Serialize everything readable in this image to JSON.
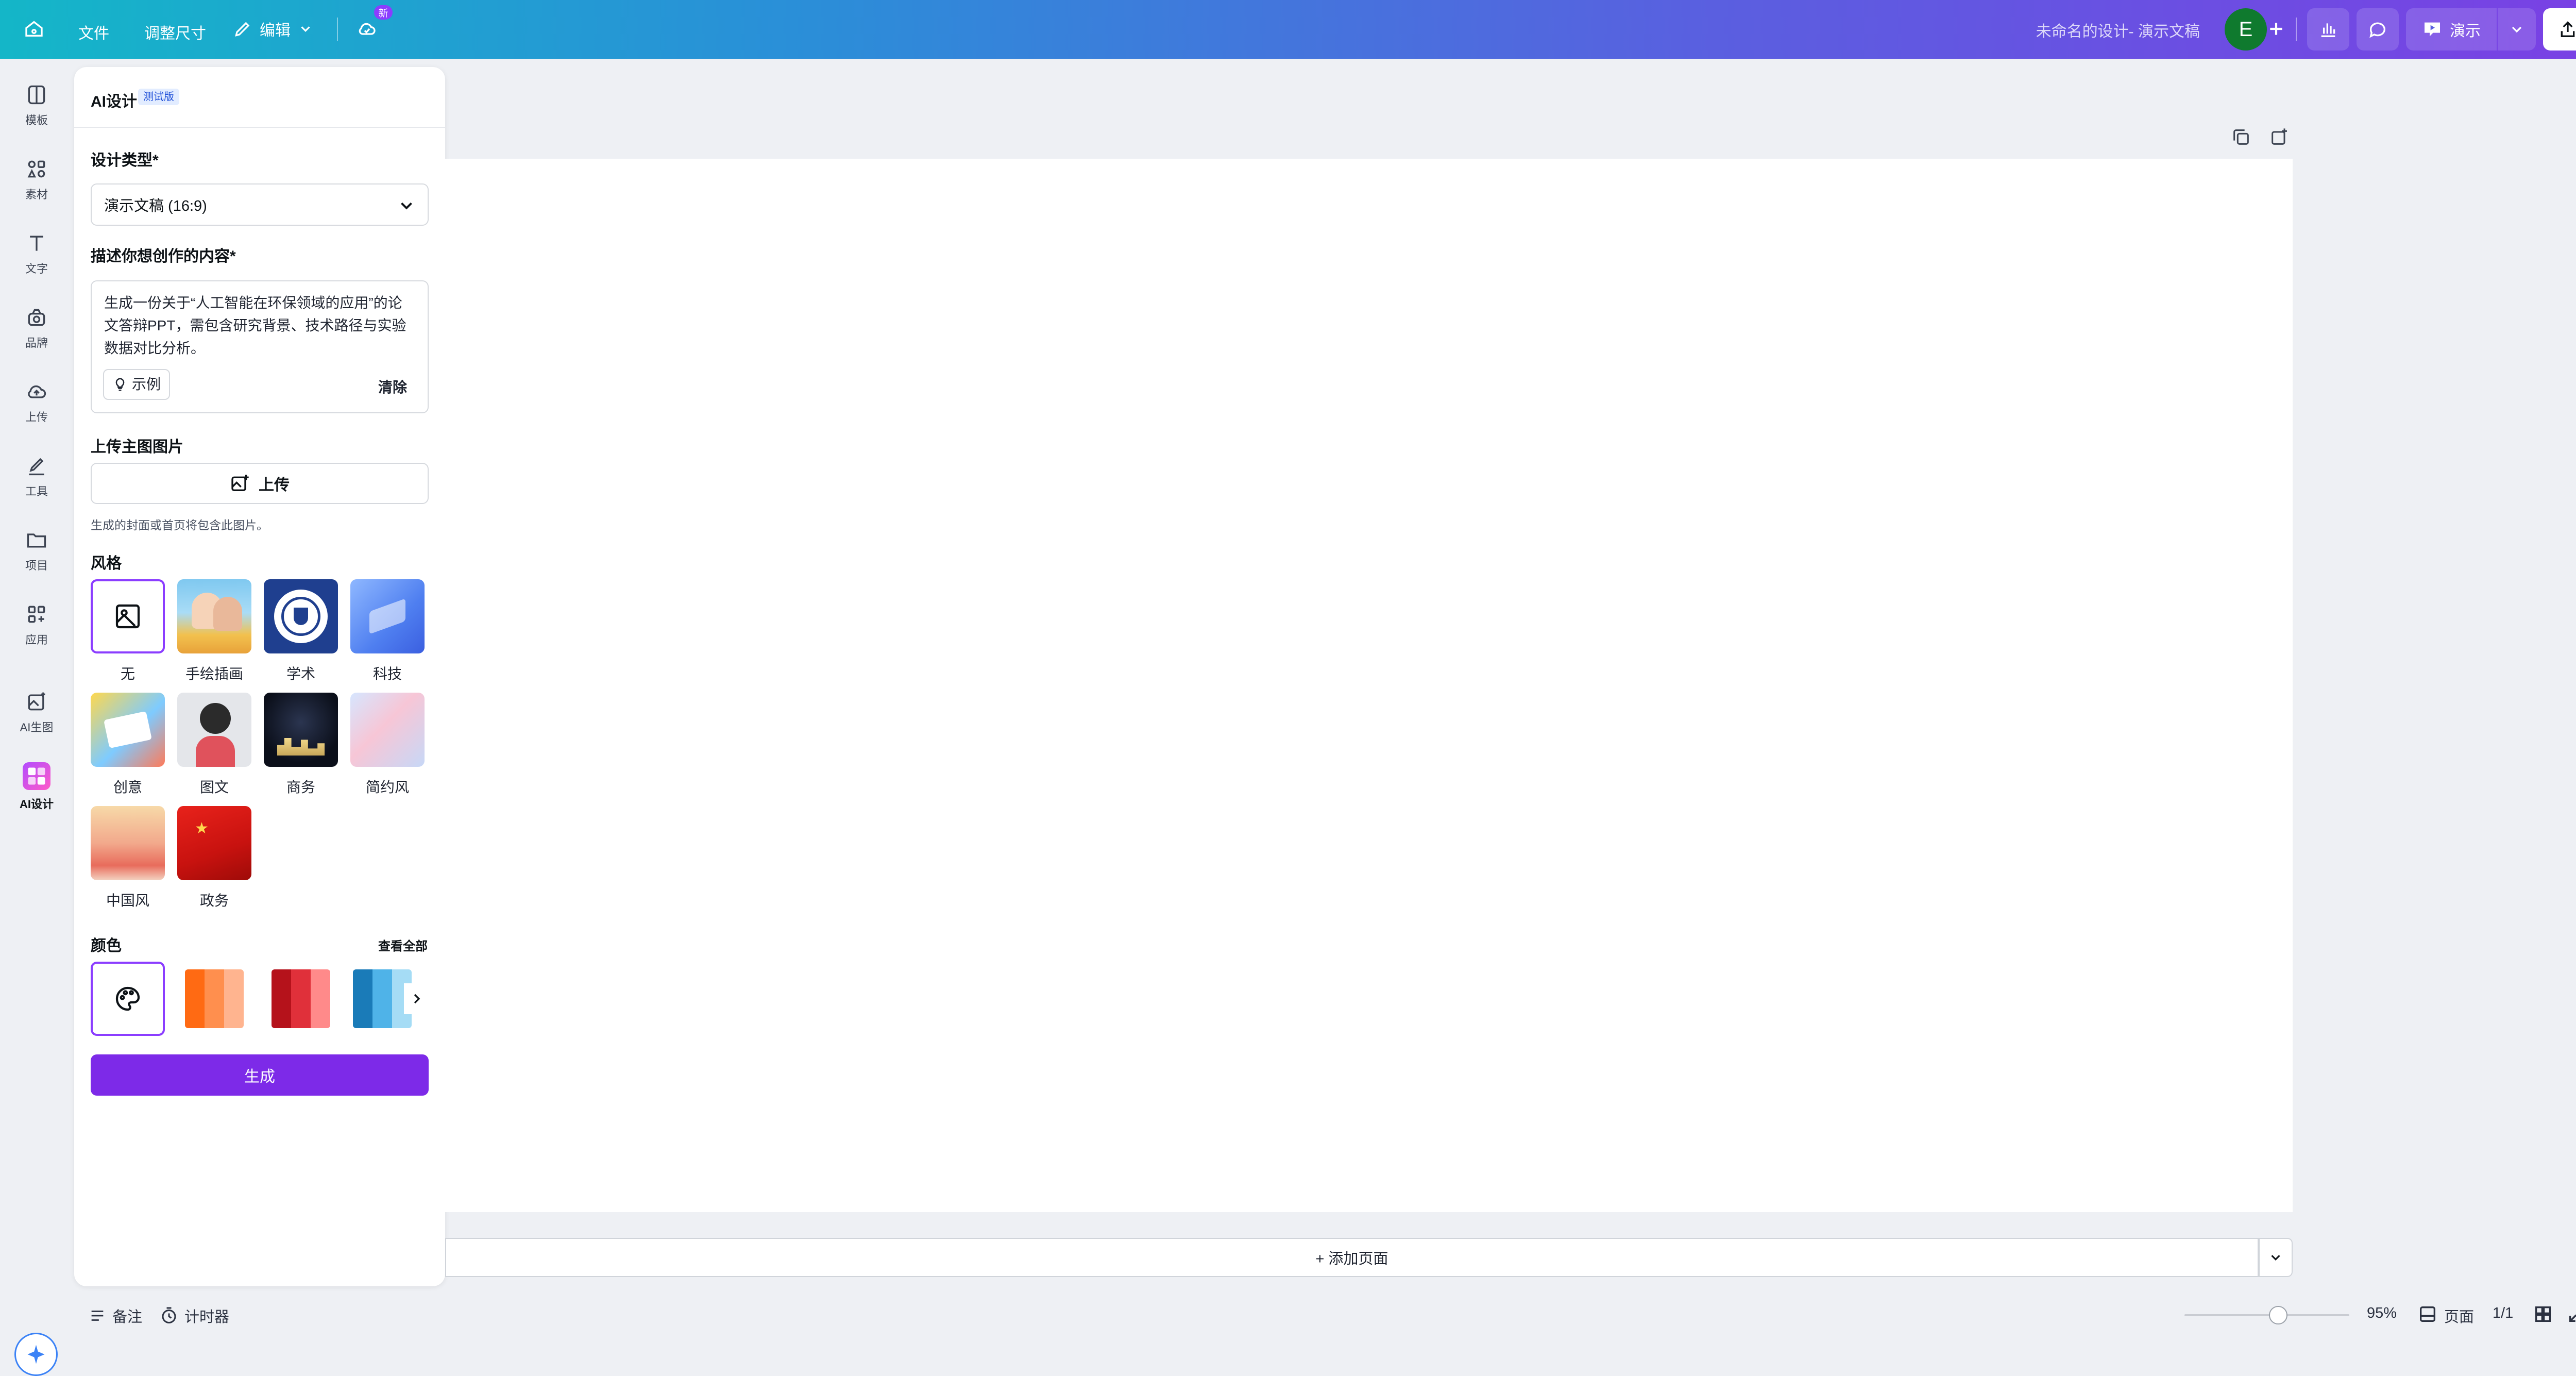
{
  "topbar": {
    "file": "文件",
    "resize": "调整尺寸",
    "edit": "编辑",
    "new_badge": "新",
    "doc_title": "未命名的设计- 演示文稿",
    "avatar_letter": "E",
    "present": "演示",
    "export": "导出"
  },
  "rail": {
    "items": [
      {
        "label": "模板",
        "icon": "template-icon"
      },
      {
        "label": "素材",
        "icon": "elements-icon"
      },
      {
        "label": "文字",
        "icon": "text-icon"
      },
      {
        "label": "品牌",
        "icon": "brand-icon"
      },
      {
        "label": "上传",
        "icon": "upload-cloud-icon"
      },
      {
        "label": "工具",
        "icon": "draw-tool-icon"
      },
      {
        "label": "项目",
        "icon": "folder-icon"
      },
      {
        "label": "应用",
        "icon": "apps-icon"
      },
      {
        "label": "AI生图",
        "icon": "ai-image-icon"
      },
      {
        "label": "AI设计",
        "icon": "ai-design-icon"
      }
    ]
  },
  "panel": {
    "title": "AI设计",
    "beta": "测试版",
    "design_type_label": "设计类型*",
    "design_type_value": "演示文稿 (16:9)",
    "describe_label": "描述你想创作的内容*",
    "describe_text": "生成一份关于“人工智能在环保领域的应用”的论文答辩PPT，需包含研究背景、技术路径与实验数据对比分析。",
    "example": "示例",
    "clear": "清除",
    "upload_label": "上传主图图片",
    "upload_button": "上传",
    "upload_hint": "生成的封面或首页将包含此图片。",
    "style_label": "风格",
    "styles": [
      "无",
      "手绘插画",
      "学术",
      "科技",
      "创意",
      "图文",
      "商务",
      "简约风",
      "中国风",
      "政务"
    ],
    "color_label": "颜色",
    "view_all": "查看全部",
    "palettes": [
      [
        "#ff6a13",
        "#ff8f4e",
        "#ffb48f"
      ],
      [
        "#b5121b",
        "#e0303a",
        "#ff8a8a"
      ],
      [
        "#1a7bb8",
        "#4fb3e8",
        "#a5dcf5"
      ]
    ],
    "generate": "生成"
  },
  "canvas": {
    "add_page": "+ 添加页面"
  },
  "bottombar": {
    "notes": "备注",
    "timer": "计时器",
    "zoom_percent": "95%",
    "zoom_level": 0.57,
    "pages": "页面",
    "page_count": "1/1"
  },
  "colors": {
    "accent": "#8b3dff",
    "generate_button": "#7d2ae8",
    "topbar_start": "#14b6c8",
    "topbar_end": "#7b3fe4"
  }
}
